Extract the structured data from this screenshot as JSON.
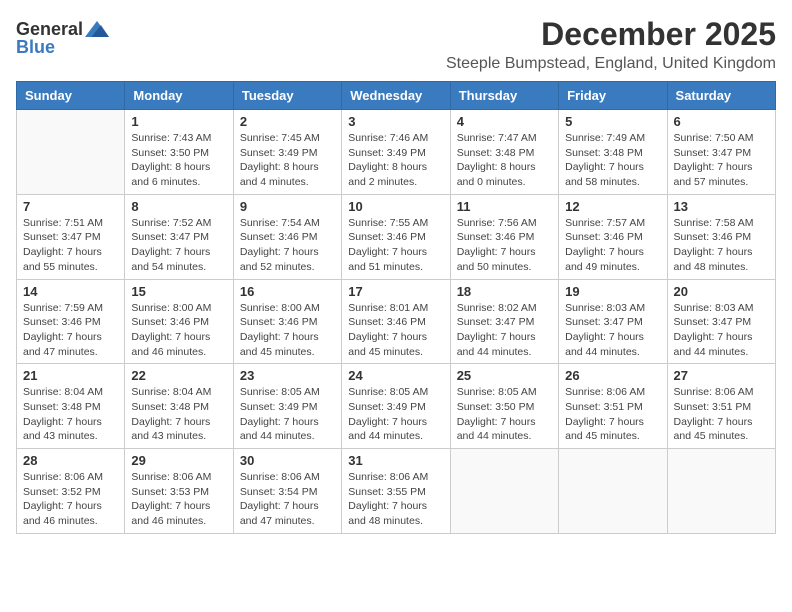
{
  "header": {
    "logo_general": "General",
    "logo_blue": "Blue",
    "month_title": "December 2025",
    "location": "Steeple Bumpstead, England, United Kingdom"
  },
  "weekdays": [
    "Sunday",
    "Monday",
    "Tuesday",
    "Wednesday",
    "Thursday",
    "Friday",
    "Saturday"
  ],
  "weeks": [
    [
      {
        "day": "",
        "info": ""
      },
      {
        "day": "1",
        "info": "Sunrise: 7:43 AM\nSunset: 3:50 PM\nDaylight: 8 hours\nand 6 minutes."
      },
      {
        "day": "2",
        "info": "Sunrise: 7:45 AM\nSunset: 3:49 PM\nDaylight: 8 hours\nand 4 minutes."
      },
      {
        "day": "3",
        "info": "Sunrise: 7:46 AM\nSunset: 3:49 PM\nDaylight: 8 hours\nand 2 minutes."
      },
      {
        "day": "4",
        "info": "Sunrise: 7:47 AM\nSunset: 3:48 PM\nDaylight: 8 hours\nand 0 minutes."
      },
      {
        "day": "5",
        "info": "Sunrise: 7:49 AM\nSunset: 3:48 PM\nDaylight: 7 hours\nand 58 minutes."
      },
      {
        "day": "6",
        "info": "Sunrise: 7:50 AM\nSunset: 3:47 PM\nDaylight: 7 hours\nand 57 minutes."
      }
    ],
    [
      {
        "day": "7",
        "info": "Sunrise: 7:51 AM\nSunset: 3:47 PM\nDaylight: 7 hours\nand 55 minutes."
      },
      {
        "day": "8",
        "info": "Sunrise: 7:52 AM\nSunset: 3:47 PM\nDaylight: 7 hours\nand 54 minutes."
      },
      {
        "day": "9",
        "info": "Sunrise: 7:54 AM\nSunset: 3:46 PM\nDaylight: 7 hours\nand 52 minutes."
      },
      {
        "day": "10",
        "info": "Sunrise: 7:55 AM\nSunset: 3:46 PM\nDaylight: 7 hours\nand 51 minutes."
      },
      {
        "day": "11",
        "info": "Sunrise: 7:56 AM\nSunset: 3:46 PM\nDaylight: 7 hours\nand 50 minutes."
      },
      {
        "day": "12",
        "info": "Sunrise: 7:57 AM\nSunset: 3:46 PM\nDaylight: 7 hours\nand 49 minutes."
      },
      {
        "day": "13",
        "info": "Sunrise: 7:58 AM\nSunset: 3:46 PM\nDaylight: 7 hours\nand 48 minutes."
      }
    ],
    [
      {
        "day": "14",
        "info": "Sunrise: 7:59 AM\nSunset: 3:46 PM\nDaylight: 7 hours\nand 47 minutes."
      },
      {
        "day": "15",
        "info": "Sunrise: 8:00 AM\nSunset: 3:46 PM\nDaylight: 7 hours\nand 46 minutes."
      },
      {
        "day": "16",
        "info": "Sunrise: 8:00 AM\nSunset: 3:46 PM\nDaylight: 7 hours\nand 45 minutes."
      },
      {
        "day": "17",
        "info": "Sunrise: 8:01 AM\nSunset: 3:46 PM\nDaylight: 7 hours\nand 45 minutes."
      },
      {
        "day": "18",
        "info": "Sunrise: 8:02 AM\nSunset: 3:47 PM\nDaylight: 7 hours\nand 44 minutes."
      },
      {
        "day": "19",
        "info": "Sunrise: 8:03 AM\nSunset: 3:47 PM\nDaylight: 7 hours\nand 44 minutes."
      },
      {
        "day": "20",
        "info": "Sunrise: 8:03 AM\nSunset: 3:47 PM\nDaylight: 7 hours\nand 44 minutes."
      }
    ],
    [
      {
        "day": "21",
        "info": "Sunrise: 8:04 AM\nSunset: 3:48 PM\nDaylight: 7 hours\nand 43 minutes."
      },
      {
        "day": "22",
        "info": "Sunrise: 8:04 AM\nSunset: 3:48 PM\nDaylight: 7 hours\nand 43 minutes."
      },
      {
        "day": "23",
        "info": "Sunrise: 8:05 AM\nSunset: 3:49 PM\nDaylight: 7 hours\nand 44 minutes."
      },
      {
        "day": "24",
        "info": "Sunrise: 8:05 AM\nSunset: 3:49 PM\nDaylight: 7 hours\nand 44 minutes."
      },
      {
        "day": "25",
        "info": "Sunrise: 8:05 AM\nSunset: 3:50 PM\nDaylight: 7 hours\nand 44 minutes."
      },
      {
        "day": "26",
        "info": "Sunrise: 8:06 AM\nSunset: 3:51 PM\nDaylight: 7 hours\nand 45 minutes."
      },
      {
        "day": "27",
        "info": "Sunrise: 8:06 AM\nSunset: 3:51 PM\nDaylight: 7 hours\nand 45 minutes."
      }
    ],
    [
      {
        "day": "28",
        "info": "Sunrise: 8:06 AM\nSunset: 3:52 PM\nDaylight: 7 hours\nand 46 minutes."
      },
      {
        "day": "29",
        "info": "Sunrise: 8:06 AM\nSunset: 3:53 PM\nDaylight: 7 hours\nand 46 minutes."
      },
      {
        "day": "30",
        "info": "Sunrise: 8:06 AM\nSunset: 3:54 PM\nDaylight: 7 hours\nand 47 minutes."
      },
      {
        "day": "31",
        "info": "Sunrise: 8:06 AM\nSunset: 3:55 PM\nDaylight: 7 hours\nand 48 minutes."
      },
      {
        "day": "",
        "info": ""
      },
      {
        "day": "",
        "info": ""
      },
      {
        "day": "",
        "info": ""
      }
    ]
  ]
}
